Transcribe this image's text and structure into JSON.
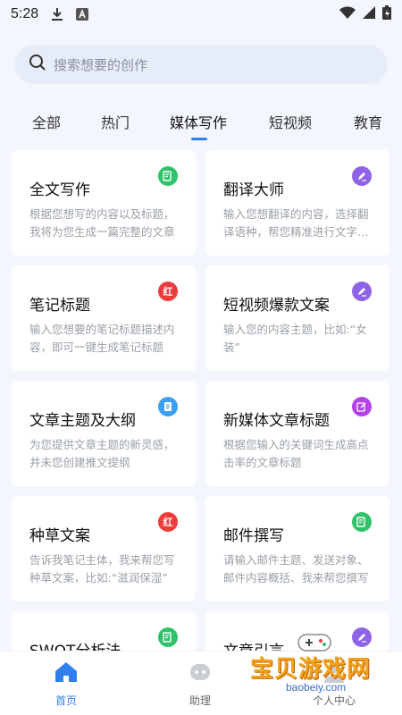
{
  "status_bar": {
    "time": "5:28",
    "icons": [
      "download-icon",
      "a-icon",
      "wifi-icon",
      "signal-icon",
      "battery-icon"
    ]
  },
  "search": {
    "placeholder": "搜索想要的创作"
  },
  "tabs": [
    {
      "label": "全部",
      "active": false
    },
    {
      "label": "热门",
      "active": false
    },
    {
      "label": "媒体写作",
      "active": true
    },
    {
      "label": "短视频",
      "active": false
    },
    {
      "label": "教育",
      "active": false
    }
  ],
  "cards": [
    {
      "title": "全文写作",
      "desc": "根据您想写的内容以及标题，我将为您生成一篇完整的文章",
      "badge_icon": "note-icon",
      "badge_color": "#2fc26b",
      "badge_text": ""
    },
    {
      "title": "翻译大师",
      "desc": "输入您想翻译的内容，选择翻译语种，帮您精准进行文字翻译",
      "badge_icon": "pen-icon",
      "badge_color": "#8e63e6",
      "badge_text": ""
    },
    {
      "title": "笔记标题",
      "desc": "输入您想要的笔记标题描述内容，即可一键生成笔记标题",
      "badge_icon": "red-icon",
      "badge_color": "#ee3b3b",
      "badge_text": "红"
    },
    {
      "title": "短视频爆款文案",
      "desc": "输入您的内容主题，比如:“女装”",
      "badge_icon": "pen-icon",
      "badge_color": "#8e63e6",
      "badge_text": ""
    },
    {
      "title": "文章主题及大纲",
      "desc": "为您提供文章主题的新灵感，并未您创建推文提纲",
      "badge_icon": "doc-icon",
      "badge_color": "#3d9ff0",
      "badge_text": ""
    },
    {
      "title": "新媒体文章标题",
      "desc": "根据您输入的关键词生成高点击率的文章标题",
      "badge_icon": "edit-icon",
      "badge_color": "#b343e8",
      "badge_text": ""
    },
    {
      "title": "种草文案",
      "desc": "告诉我笔记主体，我来帮您写种草文案，比如:“滋润保湿”",
      "badge_icon": "red-icon",
      "badge_color": "#ee3b3b",
      "badge_text": "红"
    },
    {
      "title": "邮件撰写",
      "desc": "请输入邮件主题、发送对象、邮件内容概括、我来帮您撰写",
      "badge_icon": "note-icon",
      "badge_color": "#2fc26b",
      "badge_text": ""
    },
    {
      "title": "SWOT分析法",
      "desc": "",
      "badge_icon": "note-icon",
      "badge_color": "#2fc26b",
      "badge_text": ""
    },
    {
      "title": "文章引言",
      "desc": "",
      "badge_icon": "pen-icon",
      "badge_color": "#8e63e6",
      "badge_text": ""
    }
  ],
  "bottom_nav": [
    {
      "label": "首页",
      "icon": "home-icon",
      "active": true
    },
    {
      "label": "助理",
      "icon": "assistant-icon",
      "active": false
    },
    {
      "label": "个人中心",
      "icon": "profile-icon",
      "active": false
    }
  ],
  "watermark": {
    "text": "宝贝游戏网",
    "url": "baobeiy.com"
  },
  "colors": {
    "accent": "#2f80ed",
    "background": "#f3f6fc"
  }
}
